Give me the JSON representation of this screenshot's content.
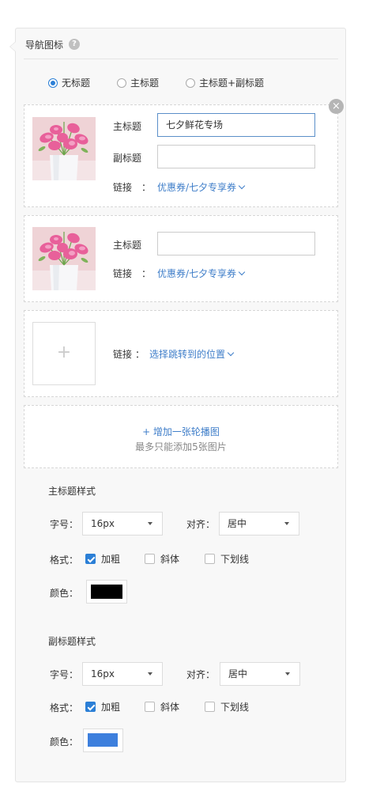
{
  "panel": {
    "title": "导航图标",
    "help_icon": "?",
    "title_mode": {
      "options": [
        "无标题",
        "主标题",
        "主标题+副标题"
      ],
      "selected": 0
    }
  },
  "cards": [
    {
      "image": "lily-bouquet-image",
      "main_title_label": "主标题",
      "main_title_value": "七夕鲜花专场",
      "sub_title_label": "副标题",
      "sub_title_value": "",
      "link_label": "链接",
      "link_value": "优惠券/七夕专享券"
    },
    {
      "image": "lily-bouquet-image",
      "main_title_label": "主标题",
      "main_title_value": "",
      "link_label": "链接",
      "link_value": "优惠券/七夕专享券"
    },
    {
      "add_image_icon": "+",
      "link_label": "链接",
      "link_value": "选择跳转到的位置"
    }
  ],
  "close_icon": "×",
  "add_slide": {
    "label": "+ 增加一张轮播图",
    "hint": "最多只能添加5张图片"
  },
  "main_style": {
    "title": "主标题样式",
    "font_size_label": "字号：",
    "font_size": "16px",
    "align_label": "对齐：",
    "align": "居中",
    "format_label": "格式：",
    "bold": "加粗",
    "italic": "斜体",
    "underline": "下划线",
    "bold_checked": true,
    "color_label": "颜色：",
    "color": "#000000"
  },
  "sub_style": {
    "title": "副标题样式",
    "font_size_label": "字号：",
    "font_size": "16px",
    "align_label": "对齐：",
    "align": "居中",
    "format_label": "格式：",
    "bold": "加粗",
    "italic": "斜体",
    "underline": "下划线",
    "bold_checked": true,
    "color_label": "颜色：",
    "color": "#3d7fdd"
  },
  "colon": "："
}
